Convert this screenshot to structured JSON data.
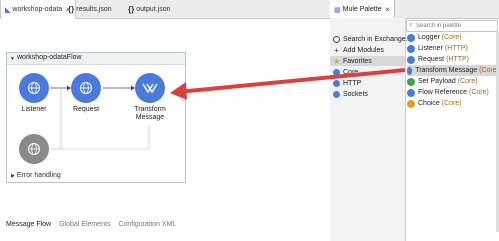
{
  "tabs": [
    {
      "label": "workshop-odata",
      "close": "✕"
    },
    {
      "label": "results.json"
    },
    {
      "label": "output.json"
    }
  ],
  "flow": {
    "title": "workshop-odataFlow",
    "nodes": [
      {
        "label": "Listener"
      },
      {
        "label": "Request"
      },
      {
        "label": "Transform Message"
      }
    ],
    "error_handling": "Error handling"
  },
  "bottom_tabs": [
    "Message Flow",
    "Global Elements",
    "Configuration XML"
  ],
  "palette": {
    "tab_label": "Mule Palette",
    "close": "✕",
    "search_placeholder": "Search in palette",
    "categories": [
      {
        "label": "Search in Exchange...",
        "icon": "exchange-icon"
      },
      {
        "label": "Add Modules",
        "icon": "plus-icon"
      },
      {
        "label": "Favorites",
        "icon": "star-icon",
        "selected": true
      },
      {
        "label": "Core",
        "icon": "core-icon"
      },
      {
        "label": "HTTP",
        "icon": "http-icon"
      },
      {
        "label": "Sockets",
        "icon": "sockets-icon"
      }
    ],
    "operations": [
      {
        "name": "Logger",
        "module": "(Core)",
        "color": "#4a7bdc"
      },
      {
        "name": "Listener",
        "module": "(HTTP)",
        "color": "#4a7bdc"
      },
      {
        "name": "Request",
        "module": "(HTTP)",
        "color": "#4a7bdc"
      },
      {
        "name": "Transform Message",
        "module": "(Core)",
        "color": "#4a7bdc",
        "highlight": true
      },
      {
        "name": "Set Payload",
        "module": "(Core)",
        "color": "#3da84a"
      },
      {
        "name": "Flow Reference",
        "module": "(Core)",
        "color": "#4a7bdc"
      },
      {
        "name": "Choice",
        "module": "(Core)",
        "color": "#e0a020"
      }
    ]
  },
  "colors": {
    "accent_arrow": "#d9413f",
    "node_blue": "#4a7bdc"
  }
}
